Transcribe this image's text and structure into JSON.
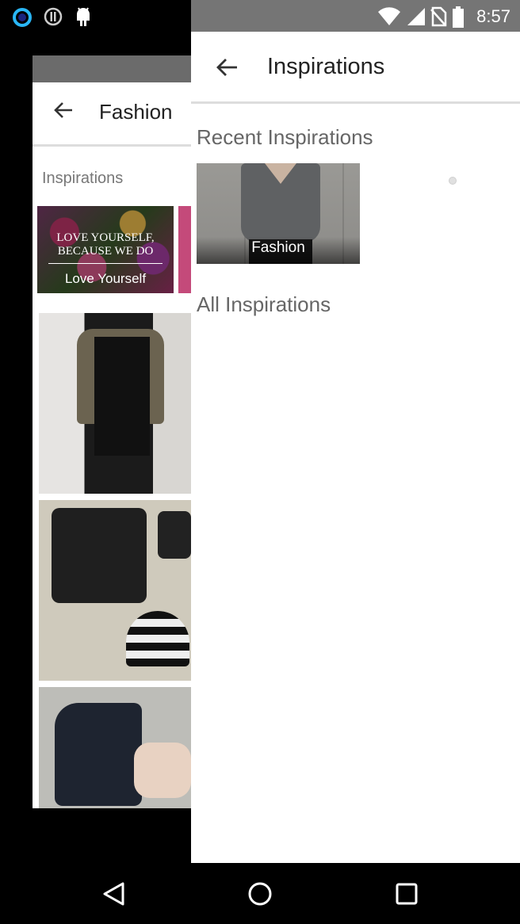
{
  "status_bar": {
    "time": "8:57",
    "icons_left": [
      "circle-ring-icon",
      "info-circle-icon",
      "android-debug-icon"
    ],
    "icons_right": [
      "wifi-icon",
      "signal-icon",
      "no-sim-icon",
      "battery-icon"
    ]
  },
  "background_screen": {
    "title": "Fashion",
    "section_label": "Inspirations",
    "card": {
      "image_text": "LOVE YOURSELF, BECAUSE WE DO",
      "label": "Love Yourself"
    }
  },
  "panel": {
    "title": "Inspirations",
    "recent_section": "Recent Inspirations",
    "recent_items": [
      {
        "label": "Fashion"
      }
    ],
    "all_section": "All Inspirations"
  },
  "nav_bar": {
    "buttons": [
      "back-icon",
      "home-icon",
      "recents-icon"
    ]
  },
  "colors": {
    "status_bar_panel": "#757575",
    "panel_bg": "#ffffff",
    "section_text": "#666666"
  }
}
